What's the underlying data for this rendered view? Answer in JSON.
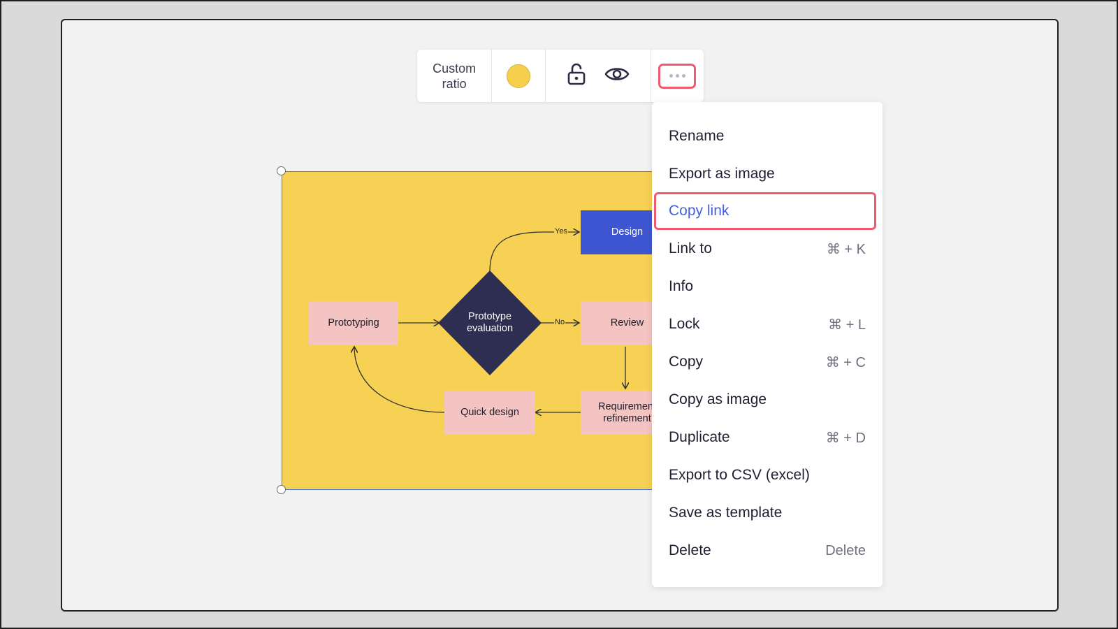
{
  "toolbar": {
    "ratio_line1": "Custom",
    "ratio_line2": "ratio",
    "color_swatch": "#f6d04d",
    "icons": [
      "unlock-icon",
      "eye-icon",
      "more-icon"
    ]
  },
  "diagram": {
    "nodes": {
      "prototyping": "Prototyping",
      "evaluation_line1": "Prototype",
      "evaluation_line2": "evaluation",
      "design": "Design",
      "review": "Review",
      "quick_design": "Quick design",
      "requirement_line1": "Requirement",
      "requirement_line2": "refinement"
    },
    "edge_labels": {
      "yes": "Yes",
      "no": "No"
    },
    "background": "#f7d154"
  },
  "menu": {
    "items": [
      {
        "label": "Rename",
        "shortcut": ""
      },
      {
        "label": "Export as image",
        "shortcut": ""
      },
      {
        "label": "Copy link",
        "shortcut": ""
      },
      {
        "label": "Link to",
        "shortcut": "⌘ + K"
      },
      {
        "label": "Info",
        "shortcut": ""
      },
      {
        "label": "Lock",
        "shortcut": "⌘ + L"
      },
      {
        "label": "Copy",
        "shortcut": "⌘ + C"
      },
      {
        "label": "Copy as image",
        "shortcut": ""
      },
      {
        "label": "Duplicate",
        "shortcut": "⌘ + D"
      },
      {
        "label": "Export to CSV (excel)",
        "shortcut": ""
      },
      {
        "label": "Save as template",
        "shortcut": ""
      },
      {
        "label": "Delete",
        "shortcut": "Delete"
      }
    ],
    "highlighted_item": "Copy link"
  },
  "colors": {
    "highlight_border": "#ef5a6f",
    "highlight_text": "#4462e0",
    "selection": "#4a74d8"
  }
}
